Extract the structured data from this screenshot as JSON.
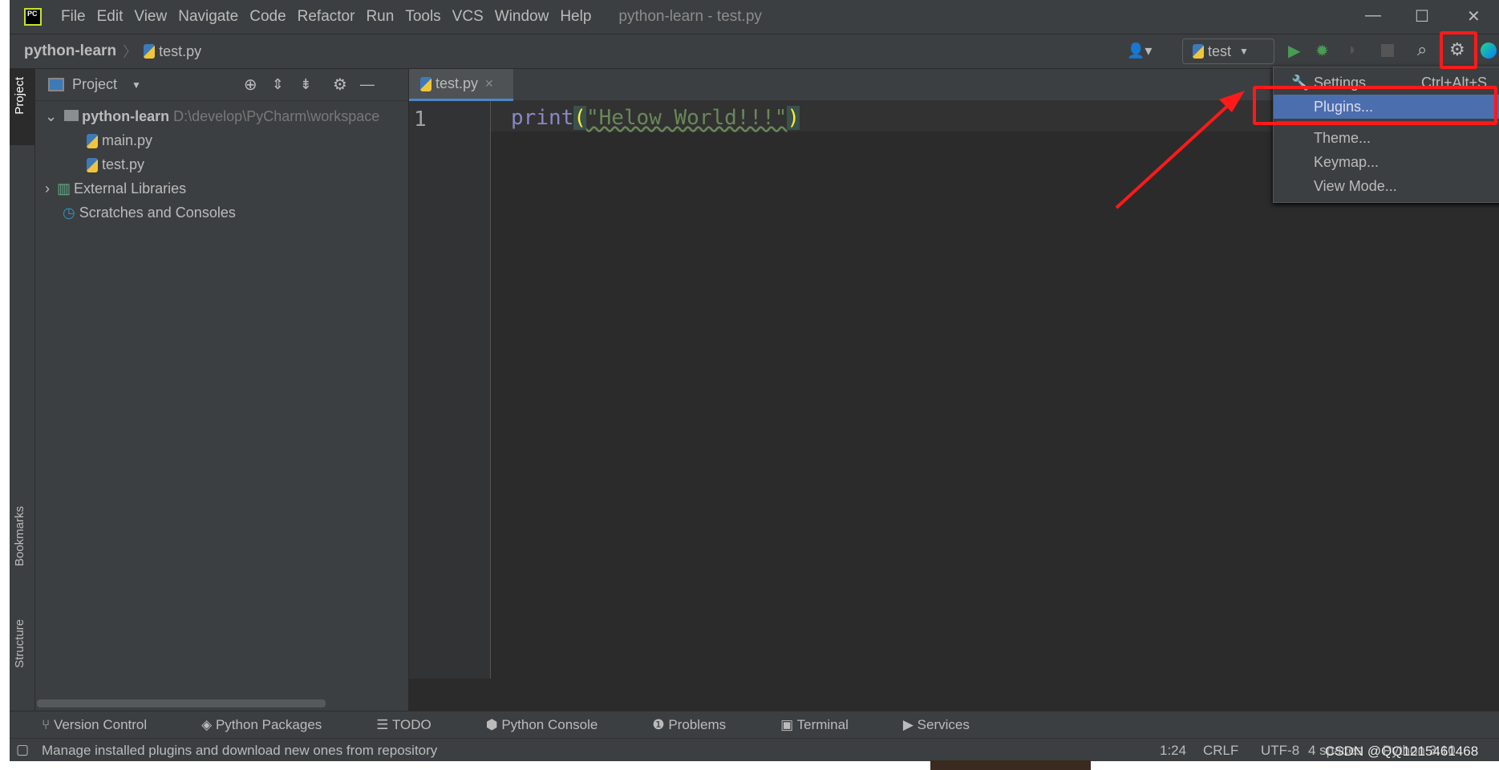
{
  "app": {
    "logo": "PC",
    "title": "python-learn - test.py"
  },
  "menu": [
    "File",
    "Edit",
    "View",
    "Navigate",
    "Code",
    "Refactor",
    "Run",
    "Tools",
    "VCS",
    "Window",
    "Help"
  ],
  "nav": {
    "project": "python-learn",
    "file": "test.py",
    "run_config": "test"
  },
  "side_tabs": {
    "project": "Project",
    "bookmarks": "Bookmarks",
    "structure": "Structure"
  },
  "project_panel": {
    "title": "Project",
    "root": "python-learn",
    "root_path": "D:\\develop\\PyCharm\\workspace",
    "files": [
      "main.py",
      "test.py"
    ],
    "external": "External Libraries",
    "scratches": "Scratches and Consoles"
  },
  "editor": {
    "tab": "test.py",
    "line_no": "1",
    "code_fn": "print",
    "code_open": "(",
    "code_str": "\"Helow World!!!\"",
    "code_close": ")"
  },
  "gear_menu": {
    "items": [
      {
        "label": "Settings",
        "shortcut": "Ctrl+Alt+S"
      },
      {
        "label": "Plugins..."
      },
      {
        "label": "Theme..."
      },
      {
        "label": "Keymap..."
      },
      {
        "label": "View Mode..."
      }
    ],
    "selected": "Plugins..."
  },
  "bottom_tools": [
    "Version Control",
    "Python Packages",
    "TODO",
    "Python Console",
    "Problems",
    "Terminal",
    "Services"
  ],
  "status": {
    "message": "Manage installed plugins and download new ones from repository",
    "position": "1:24",
    "line_sep": "CRLF",
    "encoding": "UTF-8",
    "indent": "4 spaces",
    "interpreter": "Python 3.10"
  },
  "watermark": "CSDN @QQ1215461468",
  "colors": {
    "accent": "#4b6eaf",
    "annotation": "#ff1a1a",
    "run": "#499c54"
  }
}
